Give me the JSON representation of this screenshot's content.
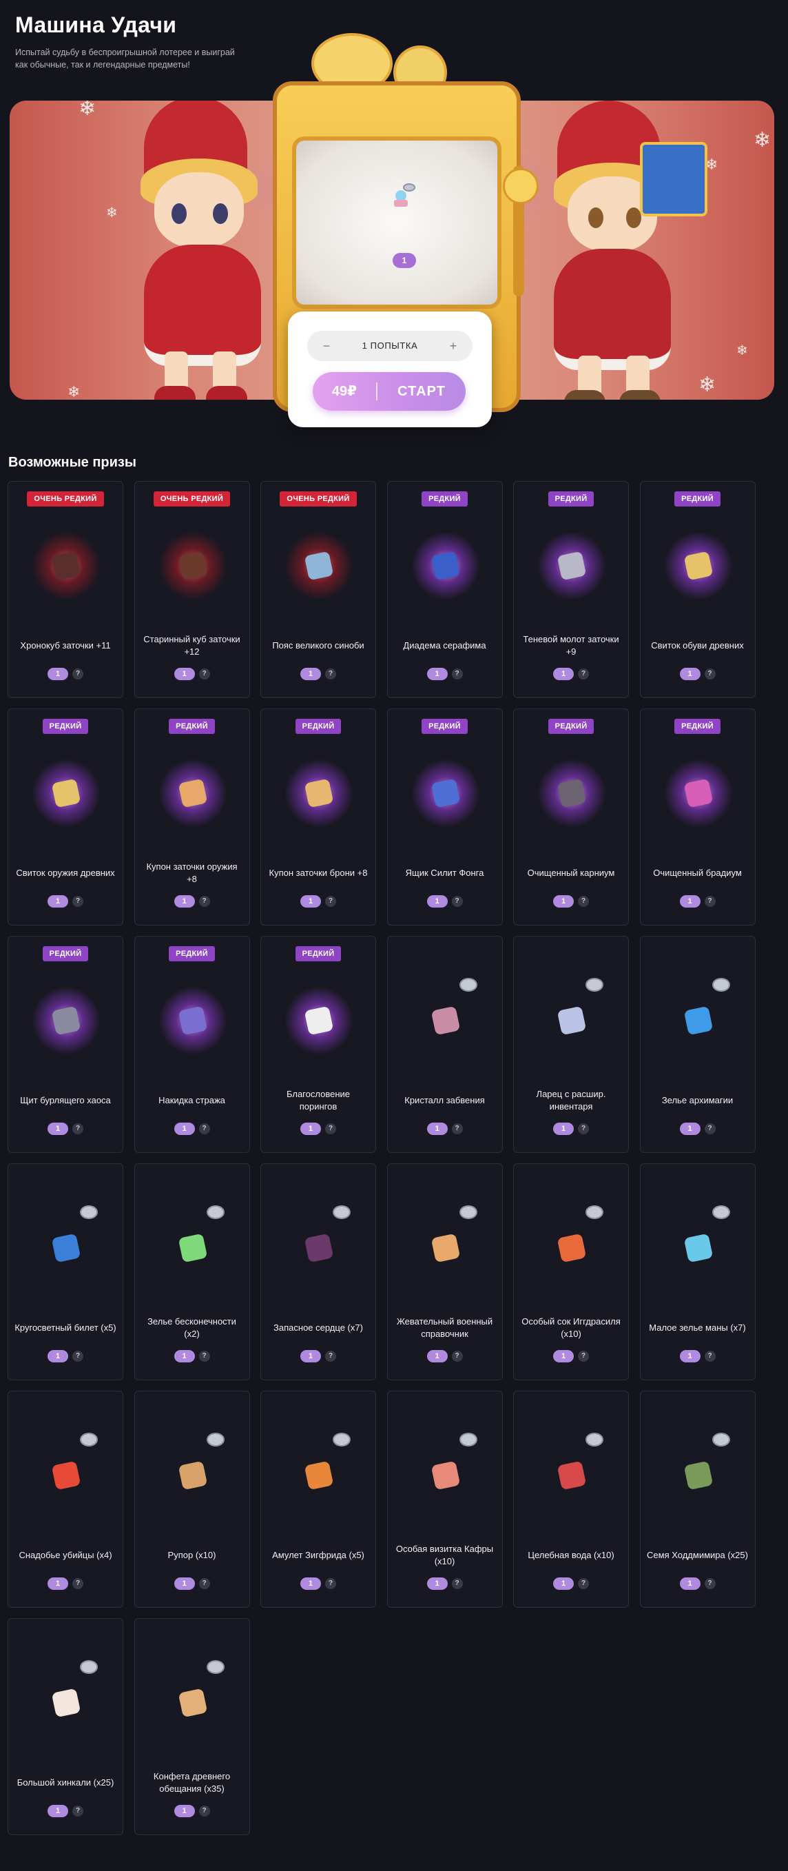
{
  "header": {
    "title": "Машина Удачи",
    "subtitle": "Испытай судьбу в беспроигрышной лотерее и выиграй как обычные, так и легендарные предметы!"
  },
  "machine": {
    "screen_count": "1",
    "quantity_label": "1 ПОПЫТКА",
    "minus": "−",
    "plus": "+",
    "price": "49₽",
    "start_label": "СТАРТ"
  },
  "prizes_title": "Возможные призы",
  "help_glyph": "?",
  "colors": {
    "very_rare": "#d42438",
    "rare": "#8e44c5",
    "accent": "#b08ae0"
  },
  "prizes": [
    {
      "rarity": "ОЧЕНЬ РЕДКИЙ",
      "tier": "vr",
      "name": "Хронокуб заточки +11",
      "count": "1",
      "icon": "cube-icon",
      "color": "#5a2e2a"
    },
    {
      "rarity": "ОЧЕНЬ РЕДКИЙ",
      "tier": "vr",
      "name": "Старинный куб заточки +12",
      "count": "1",
      "icon": "cube-icon",
      "color": "#6b3a2c"
    },
    {
      "rarity": "ОЧЕНЬ РЕДКИЙ",
      "tier": "vr",
      "name": "Пояс великого синоби",
      "count": "1",
      "icon": "belt-icon",
      "color": "#8fb6d8"
    },
    {
      "rarity": "РЕДКИЙ",
      "tier": "r",
      "name": "Диадема серафима",
      "count": "1",
      "icon": "tiara-icon",
      "color": "#3a5fc8"
    },
    {
      "rarity": "РЕДКИЙ",
      "tier": "r",
      "name": "Теневой молот заточки +9",
      "count": "1",
      "icon": "hammer-icon",
      "color": "#b8b8c8"
    },
    {
      "rarity": "РЕДКИЙ",
      "tier": "r",
      "name": "Свиток обуви древних",
      "count": "1",
      "icon": "scroll-icon",
      "color": "#e6c36a"
    },
    {
      "rarity": "РЕДКИЙ",
      "tier": "r",
      "name": "Свиток оружия древних",
      "count": "1",
      "icon": "scroll-icon",
      "color": "#e6c36a"
    },
    {
      "rarity": "РЕДКИЙ",
      "tier": "r",
      "name": "Купон заточки оружия +8",
      "count": "1",
      "icon": "coupon-icon",
      "color": "#e7a86a"
    },
    {
      "rarity": "РЕДКИЙ",
      "tier": "r",
      "name": "Купон заточки брони +8",
      "count": "1",
      "icon": "coupon-icon",
      "color": "#e9b870"
    },
    {
      "rarity": "РЕДКИЙ",
      "tier": "r",
      "name": "Ящик Силит Фонга",
      "count": "1",
      "icon": "box-icon",
      "color": "#4d6fd6"
    },
    {
      "rarity": "РЕДКИЙ",
      "tier": "r",
      "name": "Очищенный карниум",
      "count": "1",
      "icon": "ore-icon",
      "color": "#6b6470"
    },
    {
      "rarity": "РЕДКИЙ",
      "tier": "r",
      "name": "Очищенный брадиум",
      "count": "1",
      "icon": "crystal-icon",
      "color": "#d85fb8"
    },
    {
      "rarity": "РЕДКИЙ",
      "tier": "r",
      "name": "Щит бурлящего хаоса",
      "count": "1",
      "icon": "shield-icon",
      "color": "#8a8aa0"
    },
    {
      "rarity": "РЕДКИЙ",
      "tier": "r",
      "name": "Накидка стража",
      "count": "1",
      "icon": "cape-icon",
      "color": "#7a6fd0"
    },
    {
      "rarity": "РЕДКИЙ",
      "tier": "r",
      "name": "Благословение порингов",
      "count": "1",
      "icon": "orb-icon",
      "color": "#eeeeee"
    },
    {
      "rarity": "",
      "tier": "",
      "name": "Кристалл забвения",
      "count": "1",
      "icon": "crystal-icon",
      "color": "#c98ea6"
    },
    {
      "rarity": "",
      "tier": "",
      "name": "Ларец с расшир. инвентаря",
      "count": "1",
      "icon": "chest-icon",
      "color": "#b9c3e6"
    },
    {
      "rarity": "",
      "tier": "",
      "name": "Зелье архимагии",
      "count": "1",
      "icon": "potion-icon",
      "color": "#3f9be8"
    },
    {
      "rarity": "",
      "tier": "",
      "name": "Кругосветный билет (x5)",
      "count": "1",
      "icon": "ticket-icon",
      "color": "#3a7fd8"
    },
    {
      "rarity": "",
      "tier": "",
      "name": "Зелье бесконечности (x2)",
      "count": "1",
      "icon": "potion-icon",
      "color": "#7fd87a"
    },
    {
      "rarity": "",
      "tier": "",
      "name": "Запасное сердце (x7)",
      "count": "1",
      "icon": "heart-icon",
      "color": "#6b3a6a"
    },
    {
      "rarity": "",
      "tier": "",
      "name": "Жевательный военный справочник",
      "count": "1",
      "icon": "book-icon",
      "color": "#e8a96a"
    },
    {
      "rarity": "",
      "tier": "",
      "name": "Особый сок Иггдрасиля (x10)",
      "count": "1",
      "icon": "jar-icon",
      "color": "#e86a3a"
    },
    {
      "rarity": "",
      "tier": "",
      "name": "Малое зелье маны (x7)",
      "count": "1",
      "icon": "jar-icon",
      "color": "#6ac8e8"
    },
    {
      "rarity": "",
      "tier": "",
      "name": "Снадобье убийцы (x4)",
      "count": "1",
      "icon": "potion-icon",
      "color": "#e84a3a"
    },
    {
      "rarity": "",
      "tier": "",
      "name": "Рупор (x10)",
      "count": "1",
      "icon": "megaphone-icon",
      "color": "#d8a36a"
    },
    {
      "rarity": "",
      "tier": "",
      "name": "Амулет Зигфрида (x5)",
      "count": "1",
      "icon": "amulet-icon",
      "color": "#e8863a"
    },
    {
      "rarity": "",
      "tier": "",
      "name": "Особая визитка Кафры (x10)",
      "count": "1",
      "icon": "card-icon",
      "color": "#e88a7a"
    },
    {
      "rarity": "",
      "tier": "",
      "name": "Целебная вода (x10)",
      "count": "1",
      "icon": "potion-icon",
      "color": "#d84a4a"
    },
    {
      "rarity": "",
      "tier": "",
      "name": "Семя Ходдмимира (x25)",
      "count": "1",
      "icon": "seed-icon",
      "color": "#7a9a5a"
    },
    {
      "rarity": "",
      "tier": "",
      "name": "Большой хинкали (x25)",
      "count": "1",
      "icon": "dumpling-icon",
      "color": "#f3e6dc"
    },
    {
      "rarity": "",
      "tier": "",
      "name": "Конфета древнего обещания (x35)",
      "count": "1",
      "icon": "candy-icon",
      "color": "#e3b07a"
    }
  ]
}
